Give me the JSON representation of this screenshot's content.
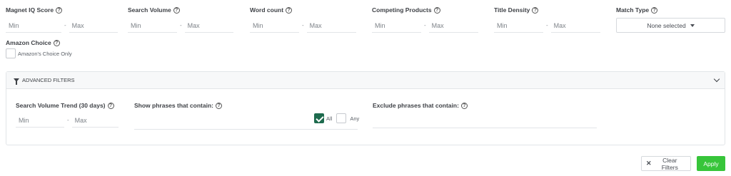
{
  "filters": {
    "magnet_iq": {
      "label": "Magnet IQ Score",
      "min_placeholder": "Min",
      "max_placeholder": "Max"
    },
    "search_volume": {
      "label": "Search Volume",
      "min_placeholder": "Min",
      "max_placeholder": "Max"
    },
    "word_count": {
      "label": "Word count",
      "min_placeholder": "Min",
      "max_placeholder": "Max"
    },
    "competing_products": {
      "label": "Competing Products",
      "min_placeholder": "Min",
      "max_placeholder": "Max"
    },
    "title_density": {
      "label": "Title Density",
      "min_placeholder": "Min",
      "max_placeholder": "Max"
    },
    "match_type": {
      "label": "Match Type",
      "selected": "None selected"
    },
    "amazon_choice": {
      "label": "Amazon Choice",
      "option": "Amazon's Choice Only",
      "checked": false
    },
    "separator": "-",
    "help_glyph": "?"
  },
  "advanced": {
    "title": "ADVANCED FILTERS",
    "search_volume_trend": {
      "label": "Search Volume Trend (30 days)",
      "min_placeholder": "Min",
      "max_placeholder": "Max"
    },
    "show_phrases": {
      "label": "Show phrases that contain:",
      "all_label": "All",
      "any_label": "Any",
      "all_checked": true,
      "any_checked": false
    },
    "exclude_phrases": {
      "label": "Exclude phrases that contain:"
    }
  },
  "actions": {
    "clear_label": "Clear Filters",
    "apply_label": "Apply"
  },
  "colors": {
    "apply_green": "#37c53a",
    "checkbox_green": "#1e6b4e"
  }
}
